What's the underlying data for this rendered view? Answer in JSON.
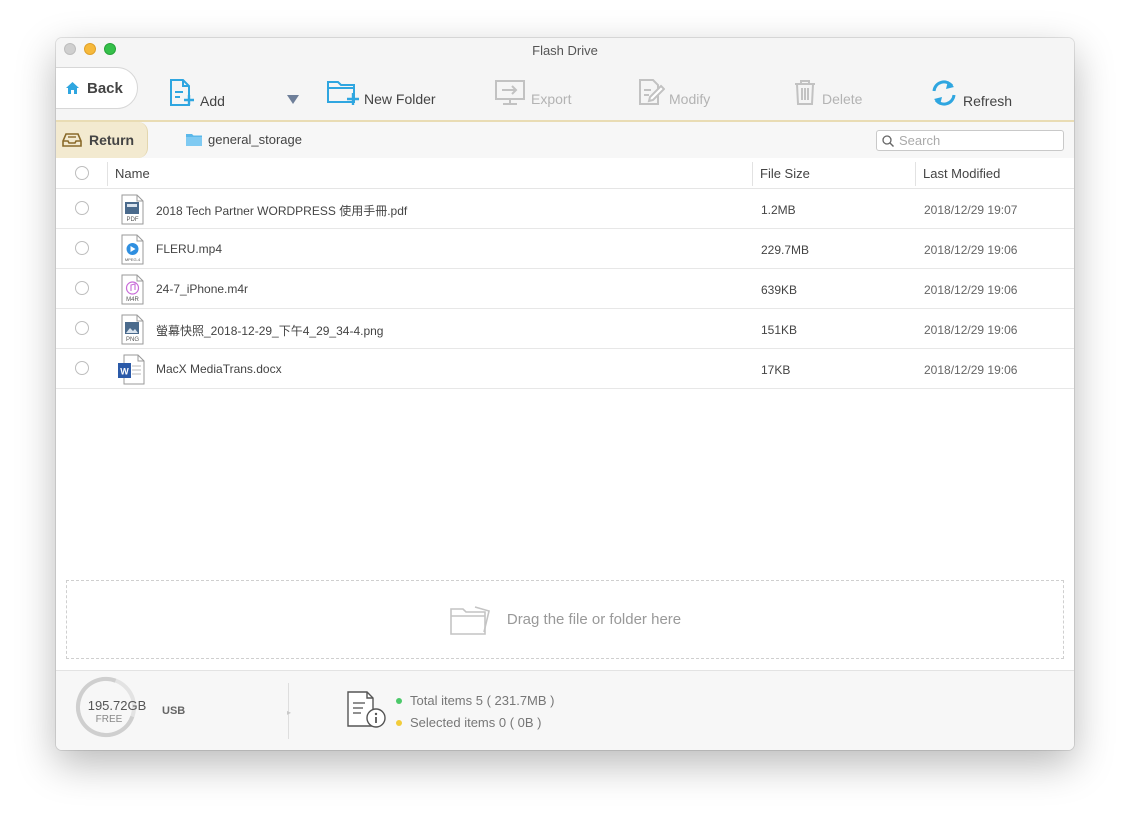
{
  "window": {
    "title": "Flash Drive"
  },
  "toolbar": {
    "back_label": "Back",
    "add_label": "Add",
    "new_folder_label": "New Folder",
    "export_label": "Export",
    "modify_label": "Modify",
    "delete_label": "Delete",
    "refresh_label": "Refresh"
  },
  "pathbar": {
    "return_label": "Return",
    "folder_name": "general_storage",
    "search_placeholder": "Search"
  },
  "table": {
    "columns": {
      "name": "Name",
      "size": "File Size",
      "modified": "Last Modified"
    },
    "rows": [
      {
        "name": "2018 Tech  Partner WORDPRESS 使用手冊.pdf",
        "size": "1.2MB",
        "modified": "2018/12/29  19:07",
        "icon": "pdf-file-icon",
        "badge": "PDF"
      },
      {
        "name": "FLERU.mp4",
        "size": "229.7MB",
        "modified": "2018/12/29  19:06",
        "icon": "video-file-icon",
        "badge": "MPEG-4"
      },
      {
        "name": "24-7_iPhone.m4r",
        "size": "639KB",
        "modified": "2018/12/29  19:06",
        "icon": "ringtone-file-icon",
        "badge": "M4R"
      },
      {
        "name": "螢幕快照_2018-12-29_下午4_29_34-4.png",
        "size": "151KB",
        "modified": "2018/12/29  19:06",
        "icon": "image-file-icon",
        "badge": "PNG"
      },
      {
        "name": "MacX MediaTrans.docx",
        "size": "17KB",
        "modified": "2018/12/29  19:06",
        "icon": "word-file-icon",
        "badge": "W"
      }
    ]
  },
  "dropzone": {
    "text": "Drag the file or folder here"
  },
  "footer": {
    "capacity": "195.72GB",
    "free_label": "FREE",
    "device": "USB",
    "total_items": "Total items 5 ( 231.7MB )",
    "selected_items": "Selected items 0 ( 0B )",
    "total_dot_color": "#4cc96a",
    "selected_dot_color": "#f2cc3a"
  },
  "colors": {
    "accent": "#2fa6e0",
    "disabled": "#b3b3b3",
    "return_tab": "#f3ead0"
  }
}
